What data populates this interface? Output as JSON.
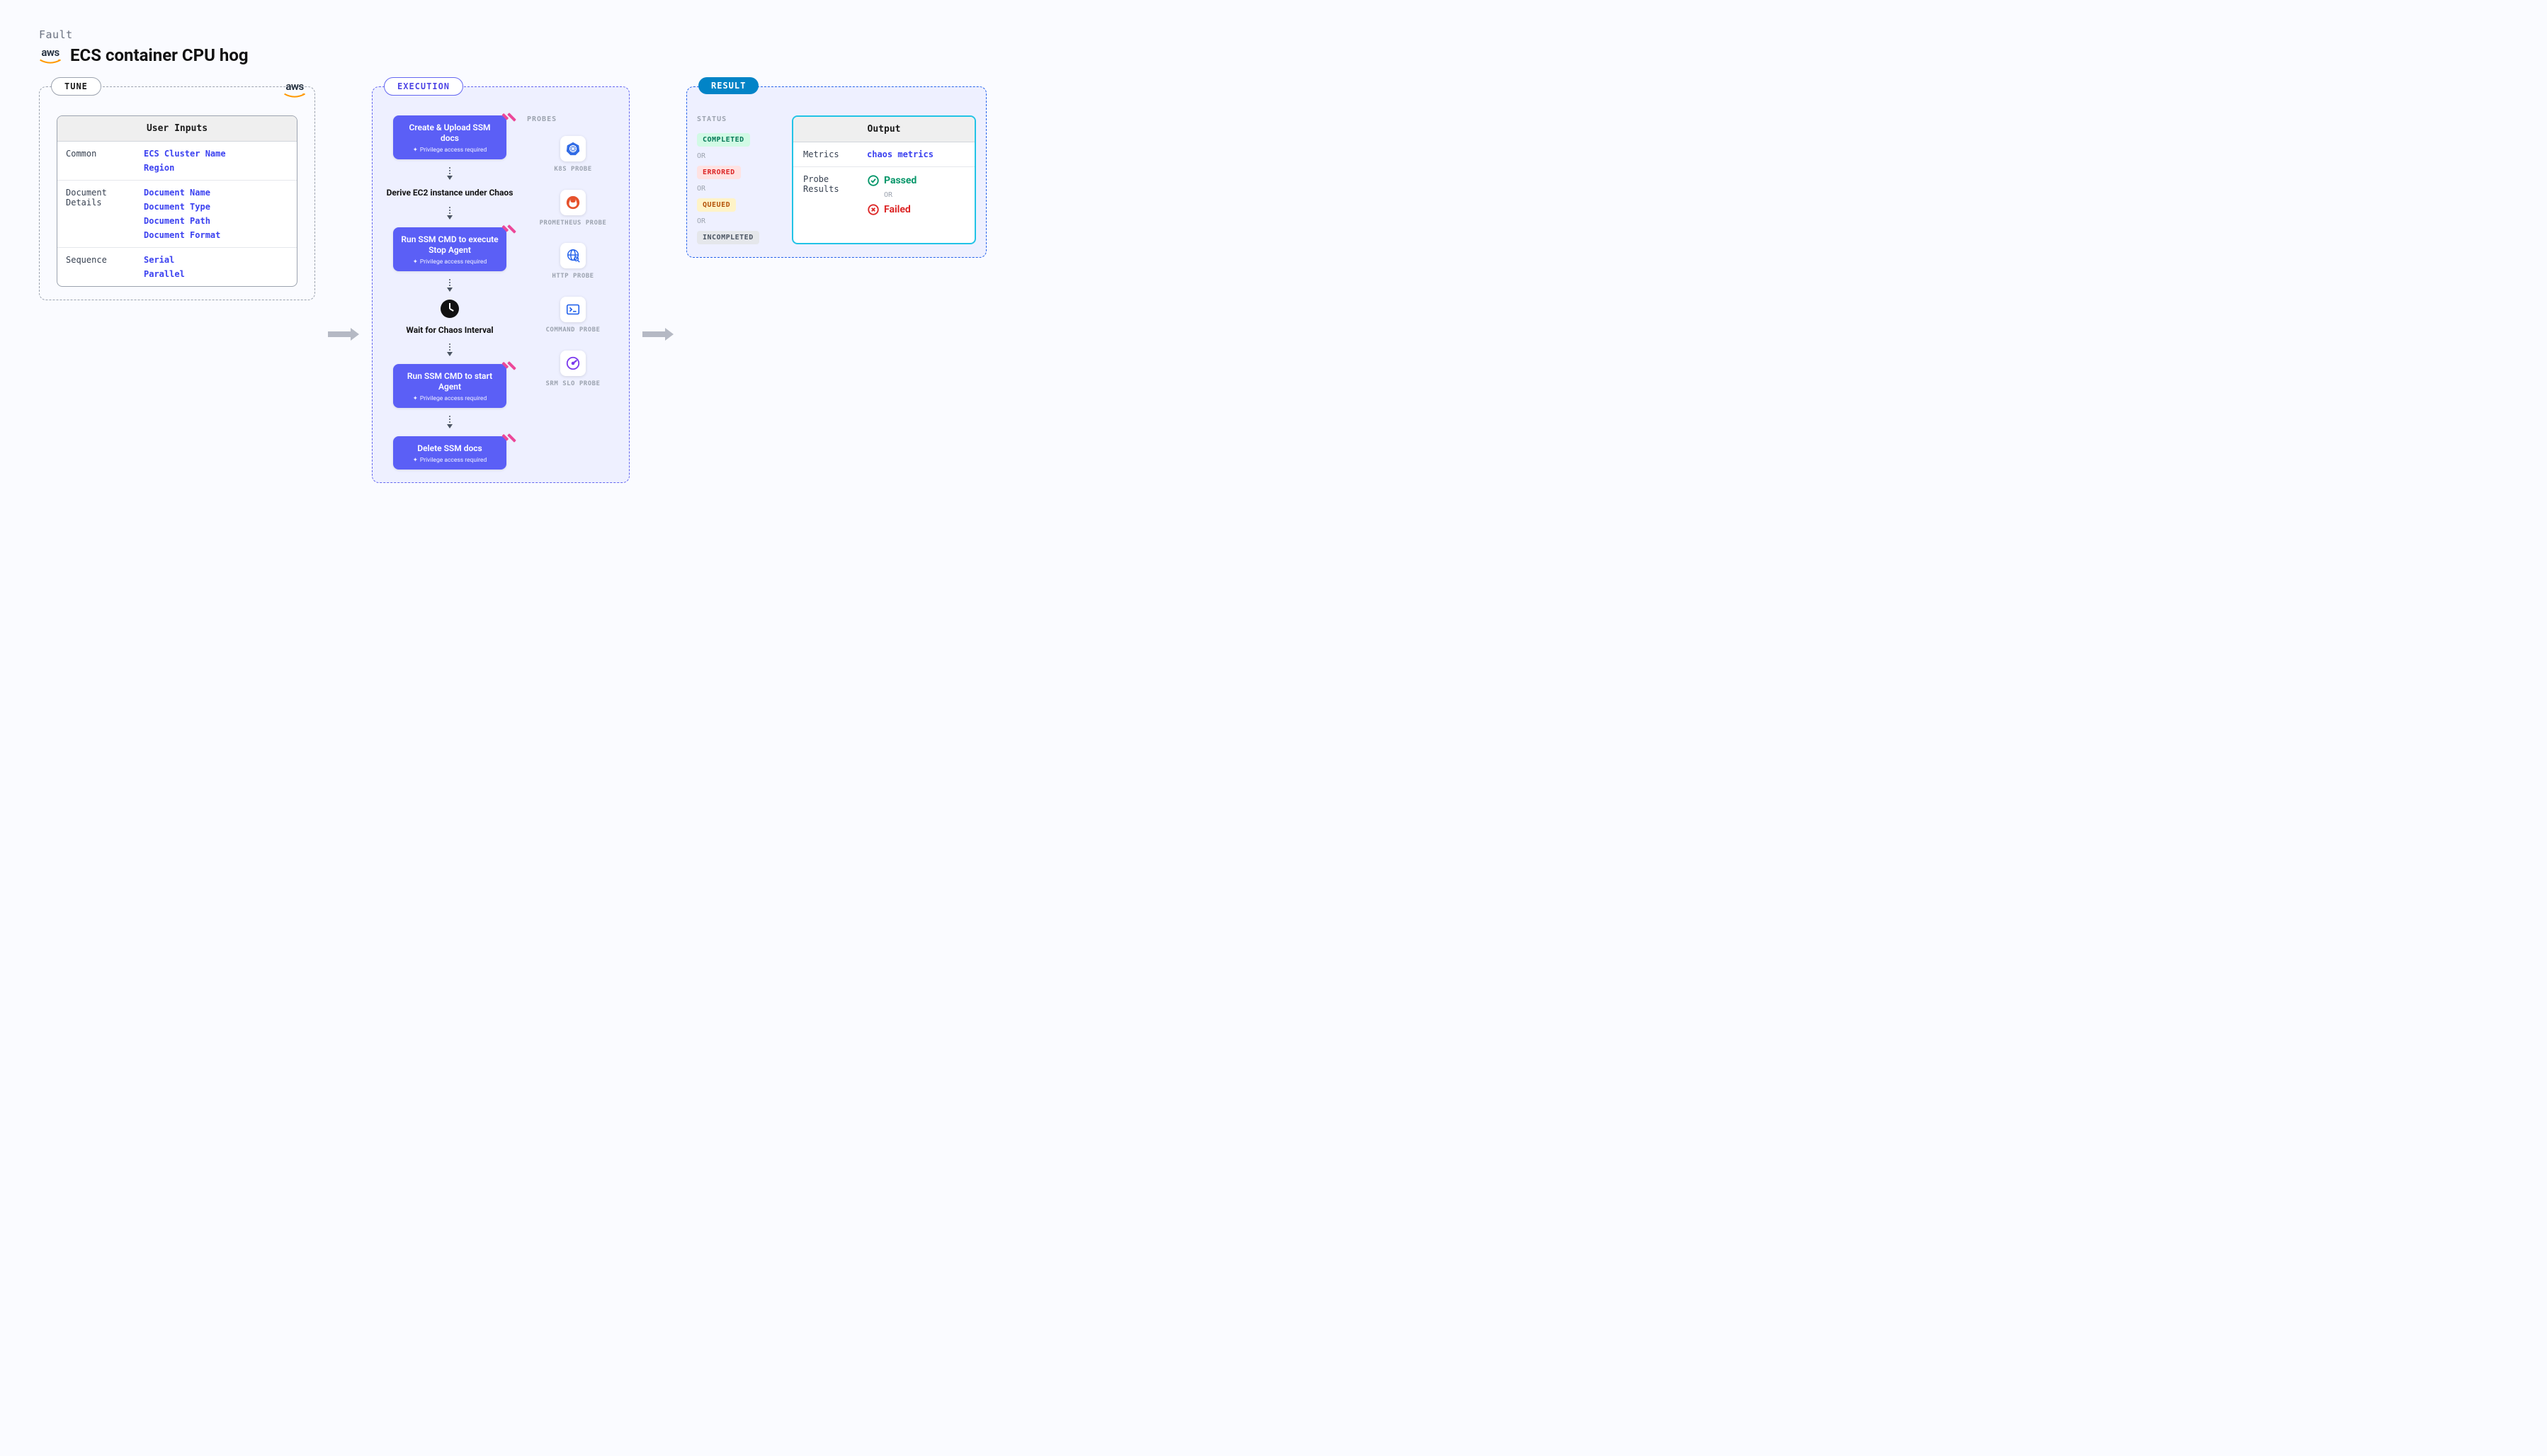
{
  "header": {
    "eyebrow": "Fault",
    "title": "ECS container CPU hog"
  },
  "tune": {
    "badge": "TUNE",
    "card_title": "User Inputs",
    "sections": [
      {
        "label": "Common",
        "values": [
          "ECS Cluster Name",
          "Region"
        ]
      },
      {
        "label": "Document Details",
        "values": [
          "Document Name",
          "Document Type",
          "Document Path",
          "Document Format"
        ]
      },
      {
        "label": "Sequence",
        "values": [
          "Serial",
          "Parallel"
        ]
      }
    ]
  },
  "execution": {
    "badge": "EXECUTION",
    "privilege_note": "Privilege access required",
    "steps": [
      {
        "kind": "card",
        "title": "Create & Upload SSM docs",
        "privileged": true
      },
      {
        "kind": "plain",
        "title": "Derive EC2 instance under Chaos"
      },
      {
        "kind": "card",
        "title": "Run SSM CMD to execute Stop Agent",
        "privileged": true
      },
      {
        "kind": "wait",
        "title": "Wait for Chaos Interval"
      },
      {
        "kind": "card",
        "title": "Run SSM CMD to start Agent",
        "privileged": true
      },
      {
        "kind": "card",
        "title": "Delete SSM docs",
        "privileged": true
      }
    ],
    "probes_title": "PROBES",
    "probes": [
      {
        "id": "k8s",
        "label": "K8S PROBE"
      },
      {
        "id": "prometheus",
        "label": "PROMETHEUS PROBE"
      },
      {
        "id": "http",
        "label": "HTTP PROBE"
      },
      {
        "id": "command",
        "label": "COMMAND PROBE"
      },
      {
        "id": "srm",
        "label": "SRM SLO PROBE"
      }
    ]
  },
  "result": {
    "badge": "RESULT",
    "status_title": "STATUS",
    "or_label": "OR",
    "statuses": [
      "COMPLETED",
      "ERRORED",
      "QUEUED",
      "INCOMPLETED"
    ],
    "output_title": "Output",
    "metrics_label": "Metrics",
    "metrics_value": "chaos metrics",
    "probe_results_label": "Probe Results",
    "passed_label": "Passed",
    "failed_label": "Failed"
  }
}
